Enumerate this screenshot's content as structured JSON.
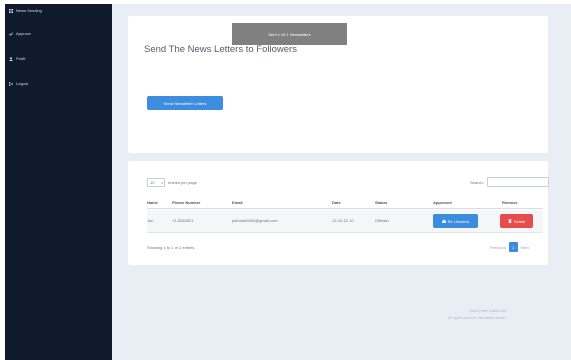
{
  "sidebar": {
    "items": [
      {
        "label": "News Sending",
        "icon": "dashboard-icon"
      },
      {
        "label": "Approve",
        "icon": "check-icon"
      },
      {
        "label": "Profit",
        "icon": "user-icon"
      },
      {
        "label": "Logout",
        "icon": "logout-icon"
      }
    ]
  },
  "toast": {
    "text": "Sent 1 Of 1 Newsletters"
  },
  "send_panel": {
    "title": "Send The News Letters to Followers",
    "button_label": "Send Newsletter Letters"
  },
  "table": {
    "entries_value": "10",
    "entries_label": "entries per page",
    "search_label": "Search:",
    "columns": [
      "Name",
      "Phone Number",
      "Email",
      "Date",
      "Status",
      "Approved",
      "Remove"
    ],
    "rows": [
      {
        "name": "Jon",
        "phone": "+1-5283321",
        "email": "johndoe0000@gmail.com",
        "date": "12-10-22 10",
        "status": "Offsider",
        "approve_label": "Re Uncheck",
        "delete_label": "Delete"
      }
    ],
    "showing_text": "Showing 1 to 1 of 1 entries",
    "pager": {
      "previous": "Previous",
      "current": "1",
      "next": "Next"
    }
  },
  "footer": {
    "line1": "News Letter Dashboard",
    "line2": "All rights reserved. Newsletter sender"
  },
  "colors": {
    "sidebar": "#0f1a2c",
    "content_background": "#e9eef5",
    "primary": "#3c8dde",
    "danger": "#e74c4c"
  }
}
